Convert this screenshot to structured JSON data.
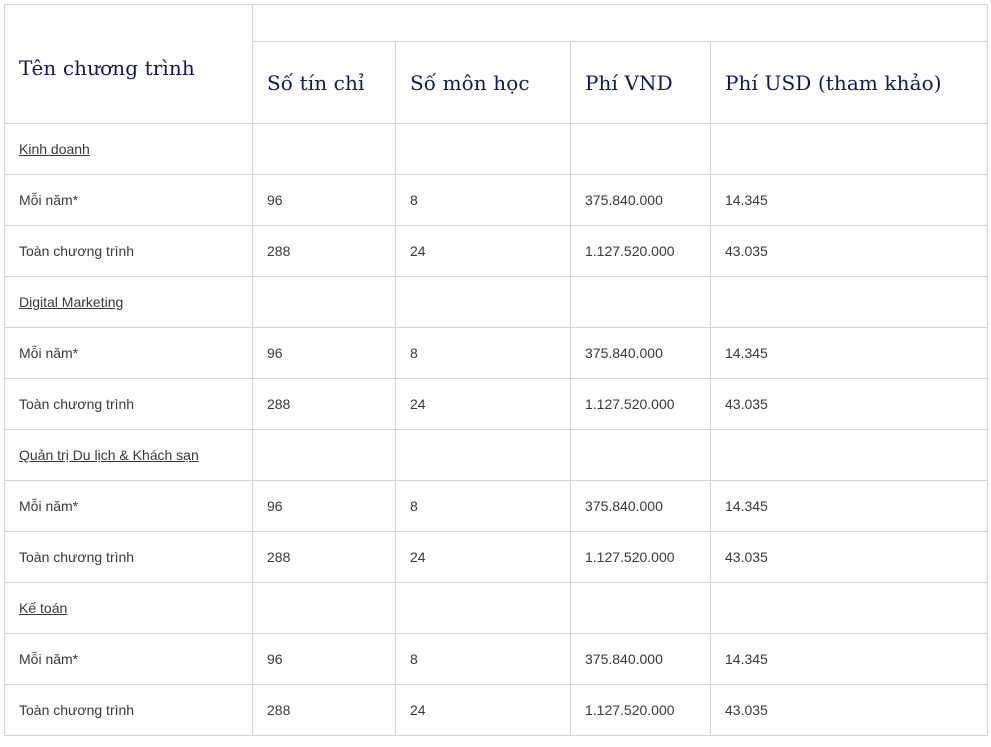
{
  "header": {
    "program_name": "Tên chương trình",
    "credits": "Số tín chỉ",
    "subjects": "Số môn học",
    "fee_vnd": "Phí VND",
    "fee_usd": "Phí USD (tham khảo)"
  },
  "sections": [
    {
      "name": "Kinh doanh",
      "rows": [
        {
          "label": "Mỗi năm*",
          "credits": "96",
          "subjects": "8",
          "vnd": "375.840.000",
          "usd": "14.345"
        },
        {
          "label": "Toàn chương trình",
          "credits": "288",
          "subjects": "24",
          "vnd": "1.127.520.000",
          "usd": "43.035"
        }
      ]
    },
    {
      "name": "Digital Marketing",
      "rows": [
        {
          "label": "Mỗi năm*",
          "credits": "96",
          "subjects": "8",
          "vnd": "375.840.000",
          "usd": "14.345"
        },
        {
          "label": "Toàn chương trình",
          "credits": "288",
          "subjects": "24",
          "vnd": "1.127.520.000",
          "usd": "43.035"
        }
      ]
    },
    {
      "name": "Quản trị Du lịch & Khách sạn",
      "rows": [
        {
          "label": "Mỗi năm*",
          "credits": "96",
          "subjects": "8",
          "vnd": "375.840.000",
          "usd": "14.345"
        },
        {
          "label": "Toàn chương trình",
          "credits": "288",
          "subjects": "24",
          "vnd": "1.127.520.000",
          "usd": "43.035"
        }
      ]
    },
    {
      "name": "Kế toán",
      "rows": [
        {
          "label": "Mỗi năm*",
          "credits": "96",
          "subjects": "8",
          "vnd": "375.840.000",
          "usd": "14.345"
        },
        {
          "label": "Toàn chương trình",
          "credits": "288",
          "subjects": "24",
          "vnd": "1.127.520.000",
          "usd": "43.035"
        }
      ]
    }
  ]
}
